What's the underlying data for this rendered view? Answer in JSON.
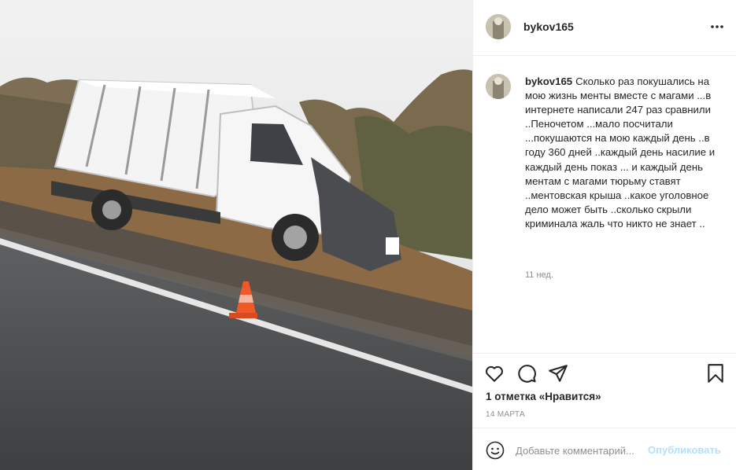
{
  "post": {
    "image_alt": "",
    "author": "bykov165",
    "more_icon": "more-horizontal-icon",
    "caption": "Сколько раз покушались на мою жизнь менты вместе с магами ...в интернете написали 247 раз сравнили ..Пеночетом ...мало посчитали ...покушаются на мою каждый день ..в году 360 дней ..каждый день насилие и каждый день показ ... и каждый день ментам с магами тюрьму ставят ..ментовская крыша ..какое уголовное дело может быть ..сколько скрыли криминала жаль что никто не знает ..",
    "time_ago": "11 нед.",
    "likes": "1 отметка «Нравится»",
    "date": "14 МАРТА"
  },
  "icons": {
    "like": "heart-icon",
    "comment": "comment-icon",
    "share": "paper-plane-icon",
    "save": "bookmark-icon",
    "emoji": "smiley-icon"
  },
  "composer": {
    "placeholder": "Добавьте комментарий...",
    "post_label": "Опубликовать"
  },
  "colors": {
    "text": "#262626",
    "muted": "#8e8e8e",
    "divider": "#efefef",
    "post_disabled": "#b2dffc"
  }
}
